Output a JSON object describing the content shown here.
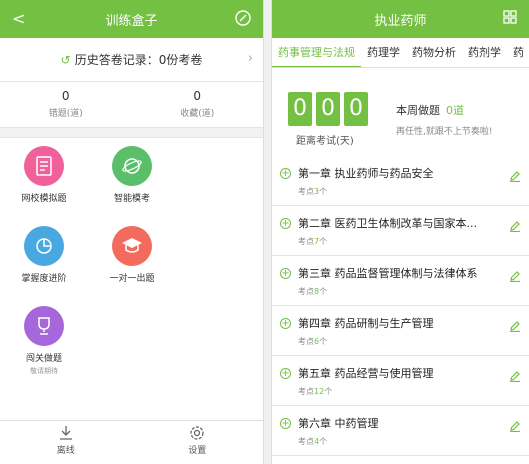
{
  "left": {
    "header_title": "训练盒子",
    "history_label": "历史答卷记录：",
    "history_value": "0份考卷",
    "stats": [
      {
        "num": "0",
        "label": "错题(道)"
      },
      {
        "num": "0",
        "label": "收藏(道)"
      }
    ],
    "grid": [
      {
        "label": "网校模拟题",
        "sub": "",
        "color": "#f0609a",
        "icon": "document-icon"
      },
      {
        "label": "智能模考",
        "sub": "",
        "color": "#5bbf6a",
        "icon": "globe-icon"
      },
      {
        "label": "掌握度进阶",
        "sub": "",
        "color": "#4aa8e0",
        "icon": "pie-chart-icon"
      },
      {
        "label": "一对一出题",
        "sub": "",
        "color": "#f36b5d",
        "icon": "graduation-cap-icon"
      },
      {
        "label": "闯关做题",
        "sub": "敬请期待",
        "color": "#a567d9",
        "icon": "trophy-icon"
      }
    ],
    "bottom": [
      {
        "label": "离线",
        "icon": "download-icon"
      },
      {
        "label": "设置",
        "icon": "gear-icon"
      }
    ]
  },
  "right": {
    "header_title": "执业药师",
    "tabs": [
      "药事管理与法规",
      "药理学",
      "药物分析",
      "药剂学",
      "药"
    ],
    "digits": [
      "0",
      "0",
      "0"
    ],
    "countdown_label": "距离考试(天)",
    "weekly_label": "本周做题",
    "weekly_value": "0道",
    "motto": "再任性,就跟不上节奏啦!",
    "chapters": [
      {
        "title": "第一章 执业药师与药品安全",
        "points_prefix": "考点",
        "points_num": "3",
        "points_suffix": "个"
      },
      {
        "title": "第二章 医药卫生体制改革与国家本...",
        "points_prefix": "考点",
        "points_num": "7",
        "points_suffix": "个"
      },
      {
        "title": "第三章 药品监督管理体制与法律体系",
        "points_prefix": "考点",
        "points_num": "8",
        "points_suffix": "个"
      },
      {
        "title": "第四章 药品研制与生产管理",
        "points_prefix": "考点",
        "points_num": "6",
        "points_suffix": "个"
      },
      {
        "title": "第五章 药品经营与使用管理",
        "points_prefix": "考点",
        "points_num": "12",
        "points_suffix": "个"
      },
      {
        "title": "第六章 中药管理",
        "points_prefix": "考点",
        "points_num": "4",
        "points_suffix": "个"
      }
    ]
  },
  "accent": "#74c043"
}
